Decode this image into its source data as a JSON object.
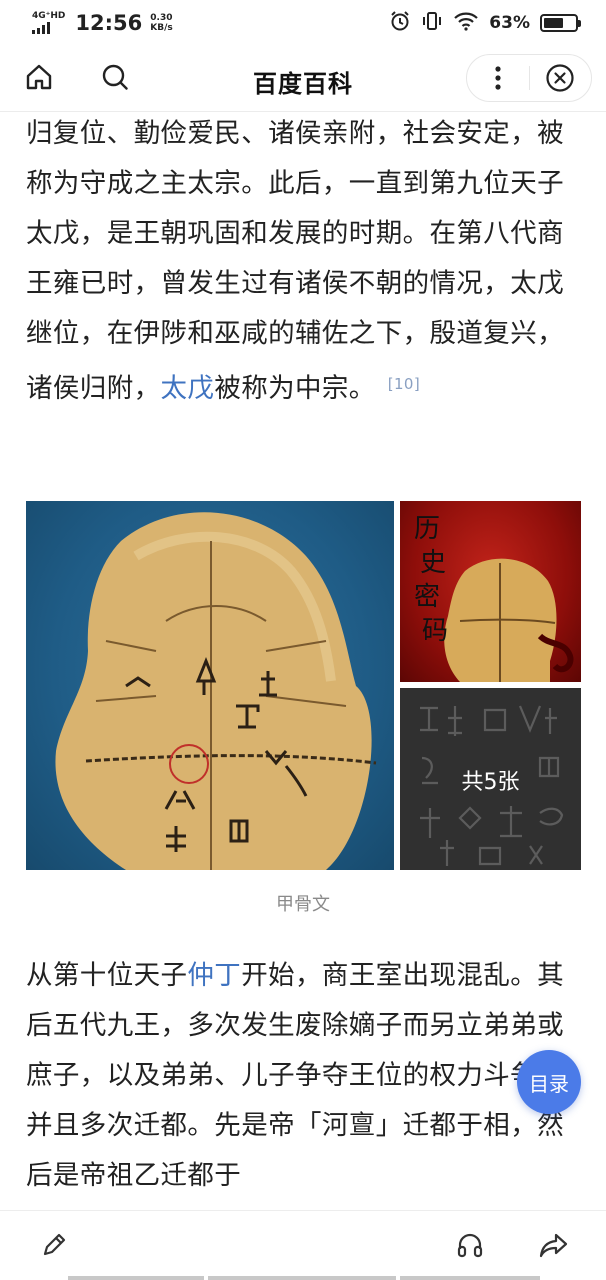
{
  "status_bar": {
    "network": "4G⁺HD",
    "time": "12:56",
    "speed_value": "0.30",
    "speed_unit": "KB/s",
    "battery_percent": "63%",
    "battery_level": 0.63,
    "icons": [
      "alarm-icon",
      "vibrate-icon",
      "wifi-icon",
      "battery-icon"
    ]
  },
  "nav": {
    "title": "百度百科",
    "icons": [
      "home-icon",
      "search-icon",
      "more-icon",
      "close-icon"
    ]
  },
  "article": {
    "para1": {
      "text": "归复位、勤俭爱民、诸侯亲附，社会安定，被称为守成之主太宗。此后，一直到第九位天子太戊，是王朝巩固和发展的时期。在第八代商王雍已时，曾发生过有诸侯不朝的情况，太戊继位，在伊陟和巫咸的辅佐之下，殷道复兴，诸侯归附，",
      "link": "太戊",
      "tail": "被称为中宗。",
      "citation": "[10]"
    },
    "gallery": {
      "caption": "甲骨文",
      "count_label": "共5张",
      "top_image_text": "历史密码"
    },
    "para2": {
      "prefix": "从第十位天子",
      "link": "仲丁",
      "text": "开始，商王室出现混乱。其后五代九王，多次发生废除嫡子而另立弟弟或庶子，以及弟弟、儿子争夺王位的权力斗争，并且多次迁都。先是帝「河亶」迁都于相，然后是帝祖乙迁都于"
    }
  },
  "toc_button": {
    "label": "目录"
  },
  "bottom_bar": {
    "icons": [
      "edit-icon",
      "headphones-icon",
      "share-icon"
    ]
  },
  "colors": {
    "link": "#3f73c0",
    "toc_button": "#4b7be8",
    "citation": "#8aa0c2"
  }
}
